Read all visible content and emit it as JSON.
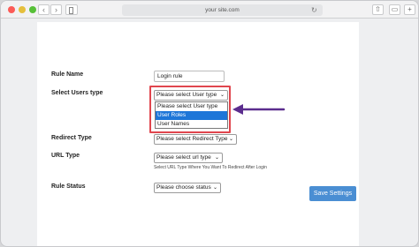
{
  "browser": {
    "url": "your site.com",
    "back_icon": "‹",
    "forward_icon": "›",
    "reload_icon": "↻",
    "share_icon": "⇧",
    "tabs_icon": "▭",
    "newtab_icon": "+"
  },
  "form": {
    "rule_name": {
      "label": "Rule Name",
      "value": "Login rule"
    },
    "users_type": {
      "label": "Select Users type",
      "selected": "Please select User type",
      "options": [
        "Please select User type",
        "User Roles",
        "User Names"
      ],
      "highlighted_option": "User Roles"
    },
    "redirect_type": {
      "label": "Redirect Type",
      "selected": "Please select Redirect Type"
    },
    "url_type": {
      "label": "URL Type",
      "selected": "Please select url type",
      "hint": "Select URL Type Where You Want To Redirect After Login"
    },
    "rule_status": {
      "label": "Rule Status",
      "selected": "Please choose status"
    },
    "save_label": "Save Settings"
  },
  "colors": {
    "accent": "#4a8ed3",
    "highlight_border": "#e0464e",
    "arrow": "#5b2d8e",
    "selected_option": "#1e76d8"
  }
}
